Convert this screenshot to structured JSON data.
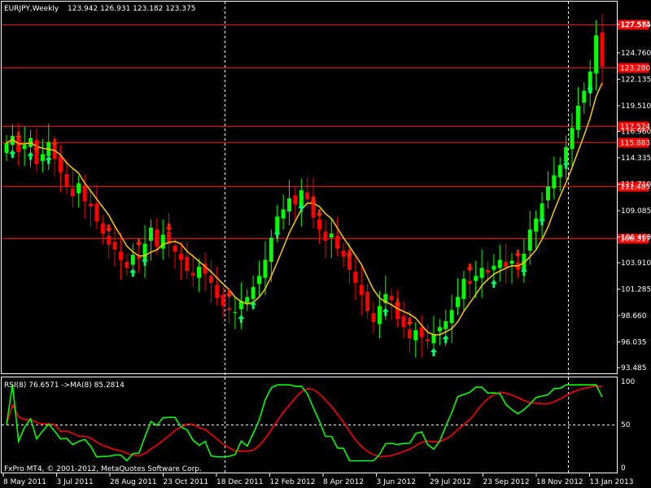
{
  "header": {
    "symbol_label": "EURJPY,Weekly",
    "ohlc": "123.942 126.931 123.182 123.375"
  },
  "colors": {
    "background": "#000000",
    "grid": "#ffffff",
    "bull_candle": "#00ff00",
    "bear_candle": "#ff0000",
    "ma_line": "#ffcc00",
    "level_line": "#ff0000",
    "rsi_line": "#00ff00",
    "rsi_ma_line": "#ff0000",
    "buy_arrow": "#00ff66",
    "sell_arrow": "#ff2200"
  },
  "price_axis": {
    "ticks": [
      "127.585",
      "124.760",
      "122.135",
      "119.510",
      "116.960",
      "114.335",
      "111.710",
      "109.085",
      "106.460",
      "103.910",
      "101.285",
      "98.660",
      "96.035",
      "93.485"
    ],
    "min": 93.485,
    "max": 127.585
  },
  "levels": [
    {
      "label": "127.574",
      "value": 127.574
    },
    {
      "label": "123.280",
      "value": 123.28
    },
    {
      "label": "117.524",
      "value": 117.524
    },
    {
      "label": "115.883",
      "value": 115.883
    },
    {
      "label": "111.485",
      "value": 111.485
    },
    {
      "label": "106.317",
      "value": 106.317
    }
  ],
  "rsi_panel": {
    "label": "RSI(8) 76.6571  ->MA(8) 85.2814",
    "ticks": [
      "100",
      "50",
      "0"
    ]
  },
  "time_axis": {
    "labels": [
      "8 May 2011",
      "3 Jul 2011",
      "28 Aug 2011",
      "23 Oct 2011",
      "18 Dec 2011",
      "12 Feb 2012",
      "8 Apr 2012",
      "3 Jun 2012",
      "29 Jul 2012",
      "23 Sep 2012",
      "18 Nov 2012",
      "13 Jan 2013"
    ]
  },
  "footer": {
    "copyright": "FxPro MT4, © 2001-2012, MetaQuotes Software Corp."
  },
  "chart_data": {
    "type": "candlestick",
    "series_closes": [
      115.8,
      116.5,
      114.9,
      115.6,
      116.3,
      113.7,
      114.7,
      115.9,
      114.2,
      112.9,
      111.5,
      110.5,
      111.8,
      110.0,
      109.5,
      108.0,
      106.8,
      105.7,
      105.2,
      104.2,
      103.4,
      104.7,
      104.3,
      105.8,
      107.4,
      105.5,
      106.7,
      105.8,
      105.0,
      104.2,
      103.1,
      102.6,
      103.5,
      102.8,
      101.9,
      100.4,
      99.6,
      99.2,
      99.0,
      100.1,
      100.5,
      101.5,
      102.6,
      104.2,
      106.4,
      108.5,
      109.2,
      110.3,
      109.7,
      111.1,
      110.2,
      108.4,
      107.2,
      106.1,
      106.8,
      105.3,
      104.5,
      103.2,
      101.9,
      100.7,
      99.1,
      98.0,
      99.6,
      100.8,
      100.2,
      98.3,
      97.5,
      96.4,
      97.2,
      96.5,
      96.1,
      96.8,
      97.5,
      98.1,
      99.2,
      100.5,
      102.3,
      101.8,
      102.6,
      103.4,
      102.9,
      103.6,
      104.2,
      103.5,
      104.1,
      103.2,
      104.8,
      107.2,
      108.3,
      109.8,
      111.5,
      112.6,
      113.6,
      115.4,
      117.3,
      119.5,
      121.0,
      122.9,
      126.5,
      123.4
    ]
  }
}
